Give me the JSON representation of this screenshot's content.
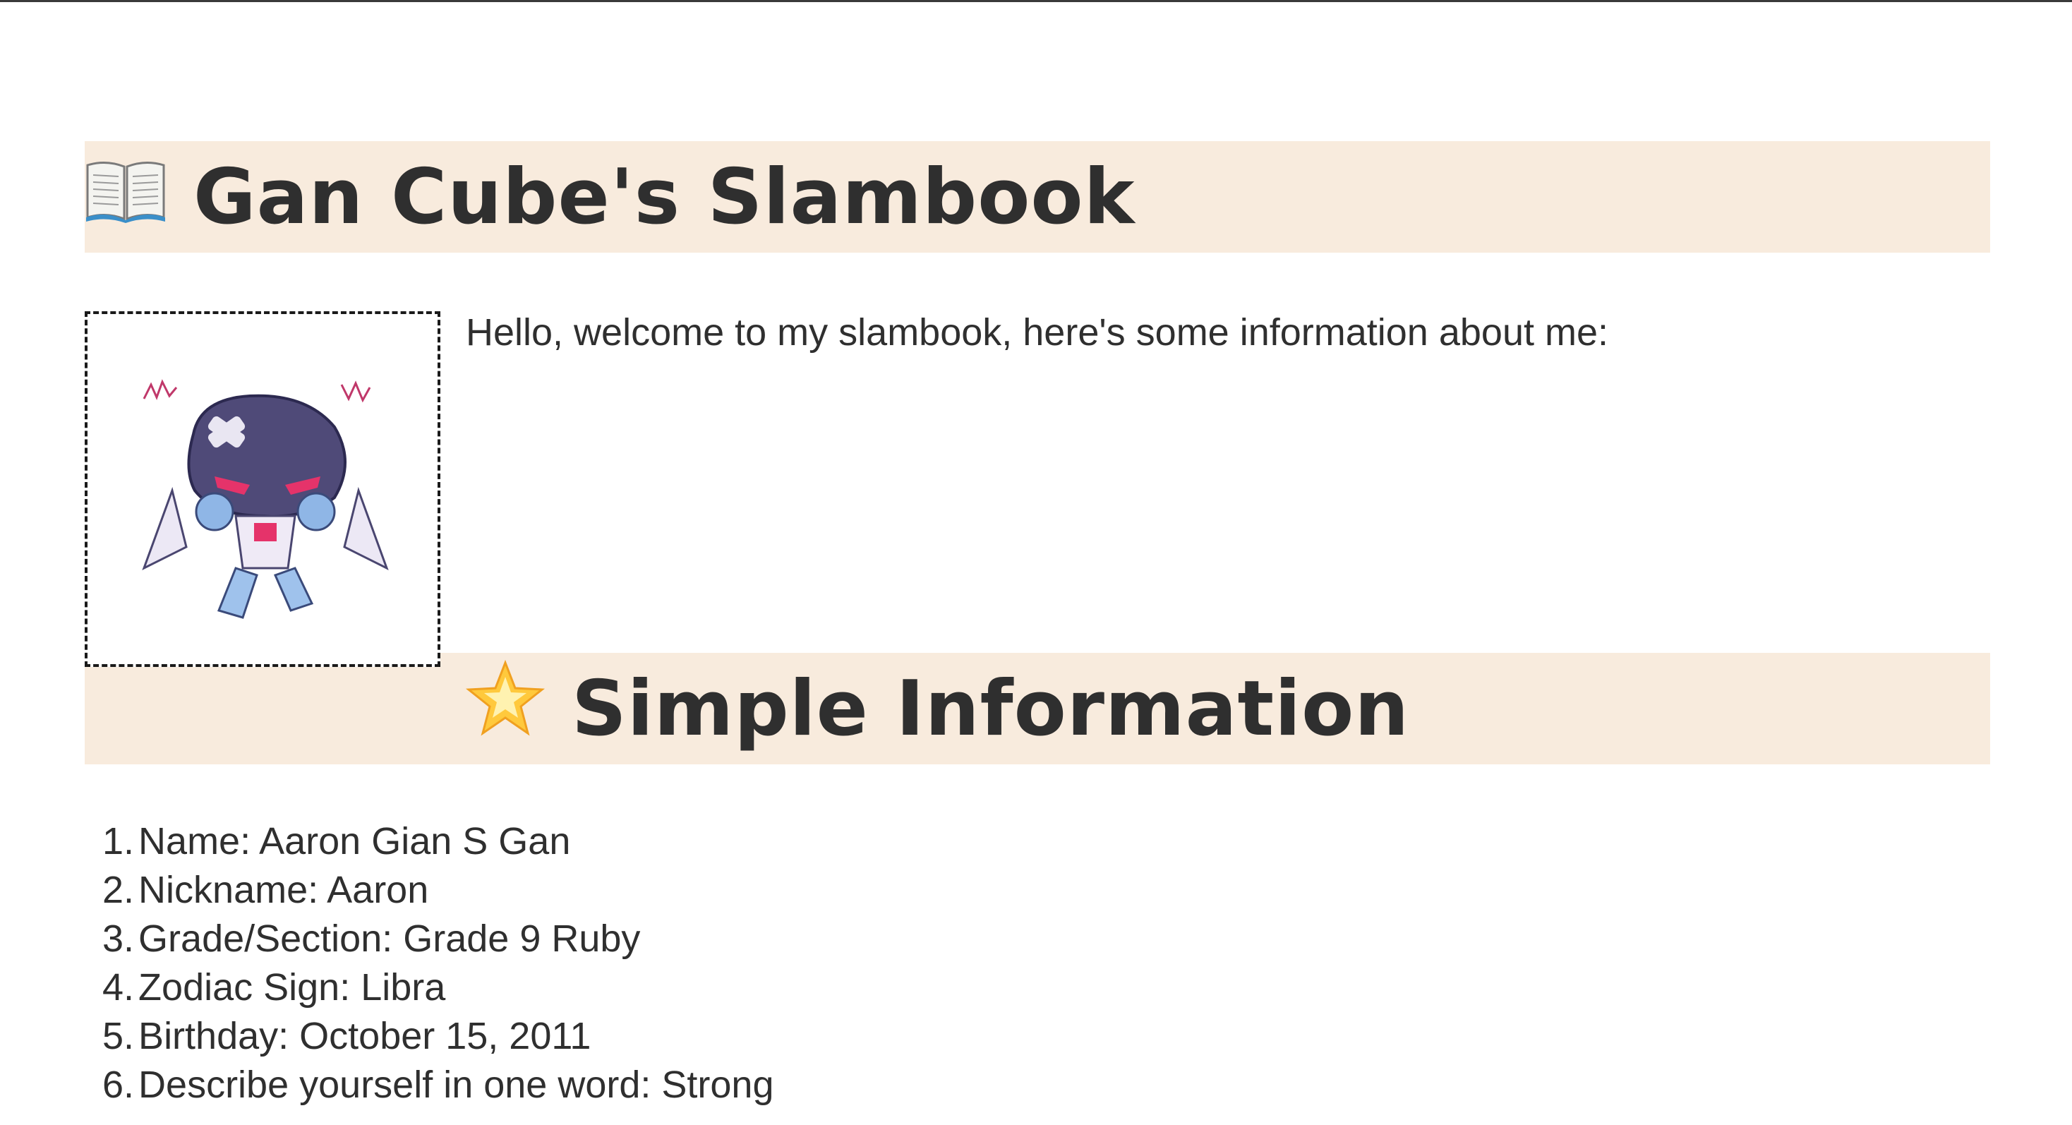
{
  "header": {
    "icon": "open-book-icon",
    "title": "Gan Cube's Slambook"
  },
  "avatar": {
    "icon": "robot-avatar-icon"
  },
  "intro": "Hello, welcome to my slambook, here's some information about me:",
  "section": {
    "icon": "glowing-star-icon",
    "title": "Simple Information"
  },
  "info_items": [
    {
      "num": "1.",
      "text": "Name: Aaron Gian S Gan"
    },
    {
      "num": "2.",
      "text": "Nickname: Aaron"
    },
    {
      "num": "3.",
      "text": "Grade/Section: Grade 9 Ruby"
    },
    {
      "num": "4.",
      "text": "Zodiac Sign: Libra"
    },
    {
      "num": "5.",
      "text": "Birthday: October 15, 2011"
    },
    {
      "num": "6.",
      "text": "Describe yourself in one word: Strong"
    }
  ],
  "colors": {
    "banner_bg": "#f8ebdd",
    "text": "#2f2f2f"
  }
}
